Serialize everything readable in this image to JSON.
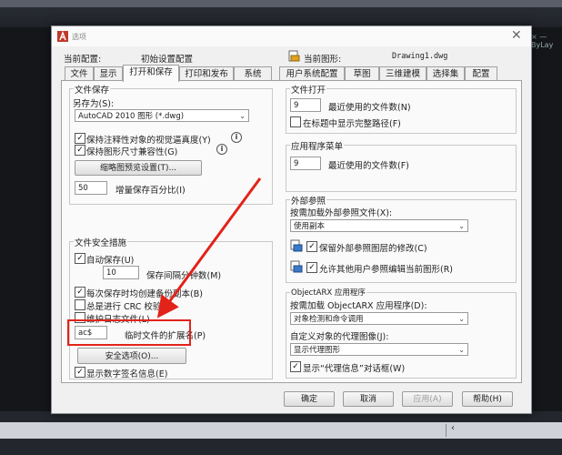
{
  "dialog": {
    "title": "选项",
    "current_profile_label": "当前配置:",
    "current_profile_value": "初始设置配置",
    "current_drawing_label": "当前图形:",
    "current_drawing_value": "Drawing1.dwg"
  },
  "background": {
    "crosshair_readout": "× — ByLay"
  },
  "tabs": [
    "文件",
    "显示",
    "打开和保存",
    "打印和发布",
    "系统",
    "用户系统配置",
    "草图",
    "三维建模",
    "选择集",
    "配置"
  ],
  "active_tab": "打开和保存",
  "file_save": {
    "title": "文件保存",
    "save_as_label": "另存为(S):",
    "save_as_value": "AutoCAD 2010 图形 (*.dwg)",
    "annotative_visual_fidelity": {
      "label": "保持注释性对象的视觉逼真度(Y)",
      "checked": true
    },
    "drawing_size_compat": {
      "label": "保持图形尺寸兼容性(G)",
      "checked": true
    },
    "thumbnail_button": "缩略图预览设置(T)...",
    "incremental_value": "50",
    "incremental_label": "增量保存百分比(I)"
  },
  "file_safety": {
    "title": "文件安全措施",
    "autosave": {
      "label": "自动保存(U)",
      "checked": true
    },
    "autosave_minutes": "10",
    "autosave_interval_label": "保存间隔分钟数(M)",
    "backup_copy": {
      "label": "每次保存时均创建备份副本(B)",
      "checked": true
    },
    "crc_check": {
      "label": "总是进行 CRC 校验(V)",
      "checked": false
    },
    "log_file": {
      "label": "维护日志文件(L)",
      "checked": false
    },
    "temp_ext_value": "ac$",
    "temp_ext_label": "临时文件的扩展名(P)",
    "security_button": "安全选项(O)...",
    "digital_signature": {
      "label": "显示数字签名信息(E)",
      "checked": true
    }
  },
  "file_open": {
    "title": "文件打开",
    "recent_count": "9",
    "recent_label": "最近使用的文件数(N)",
    "full_path": {
      "label": "在标题中显示完整路径(F)",
      "checked": false
    }
  },
  "app_menu": {
    "title": "应用程序菜单",
    "recent_count": "9",
    "recent_label": "最近使用的文件数(F)"
  },
  "xref": {
    "title": "外部参照",
    "demand_load_label": "按需加载外部参照文件(X):",
    "demand_load_value": "使用副本",
    "retain_changes": {
      "label": "保留外部参照图层的修改(C)",
      "checked": true
    },
    "allow_edit": {
      "label": "允许其他用户参照编辑当前图形(R)",
      "checked": true
    }
  },
  "objectarx": {
    "title": "ObjectARX 应用程序",
    "demand_load_label": "按需加载 ObjectARX 应用程序(D):",
    "demand_load_value": "对象检测和命令调用",
    "proxy_images_label": "自定义对象的代理图像(J):",
    "proxy_images_value": "显示代理图形",
    "proxy_info": {
      "label": "显示“代理信息”对话框(W)",
      "checked": true
    }
  },
  "buttons": {
    "ok": "确定",
    "cancel": "取消",
    "apply": "应用(A)",
    "help": "帮助(H)"
  },
  "colors": {
    "highlight": "#e2231a",
    "arrow": "#e2231a"
  }
}
